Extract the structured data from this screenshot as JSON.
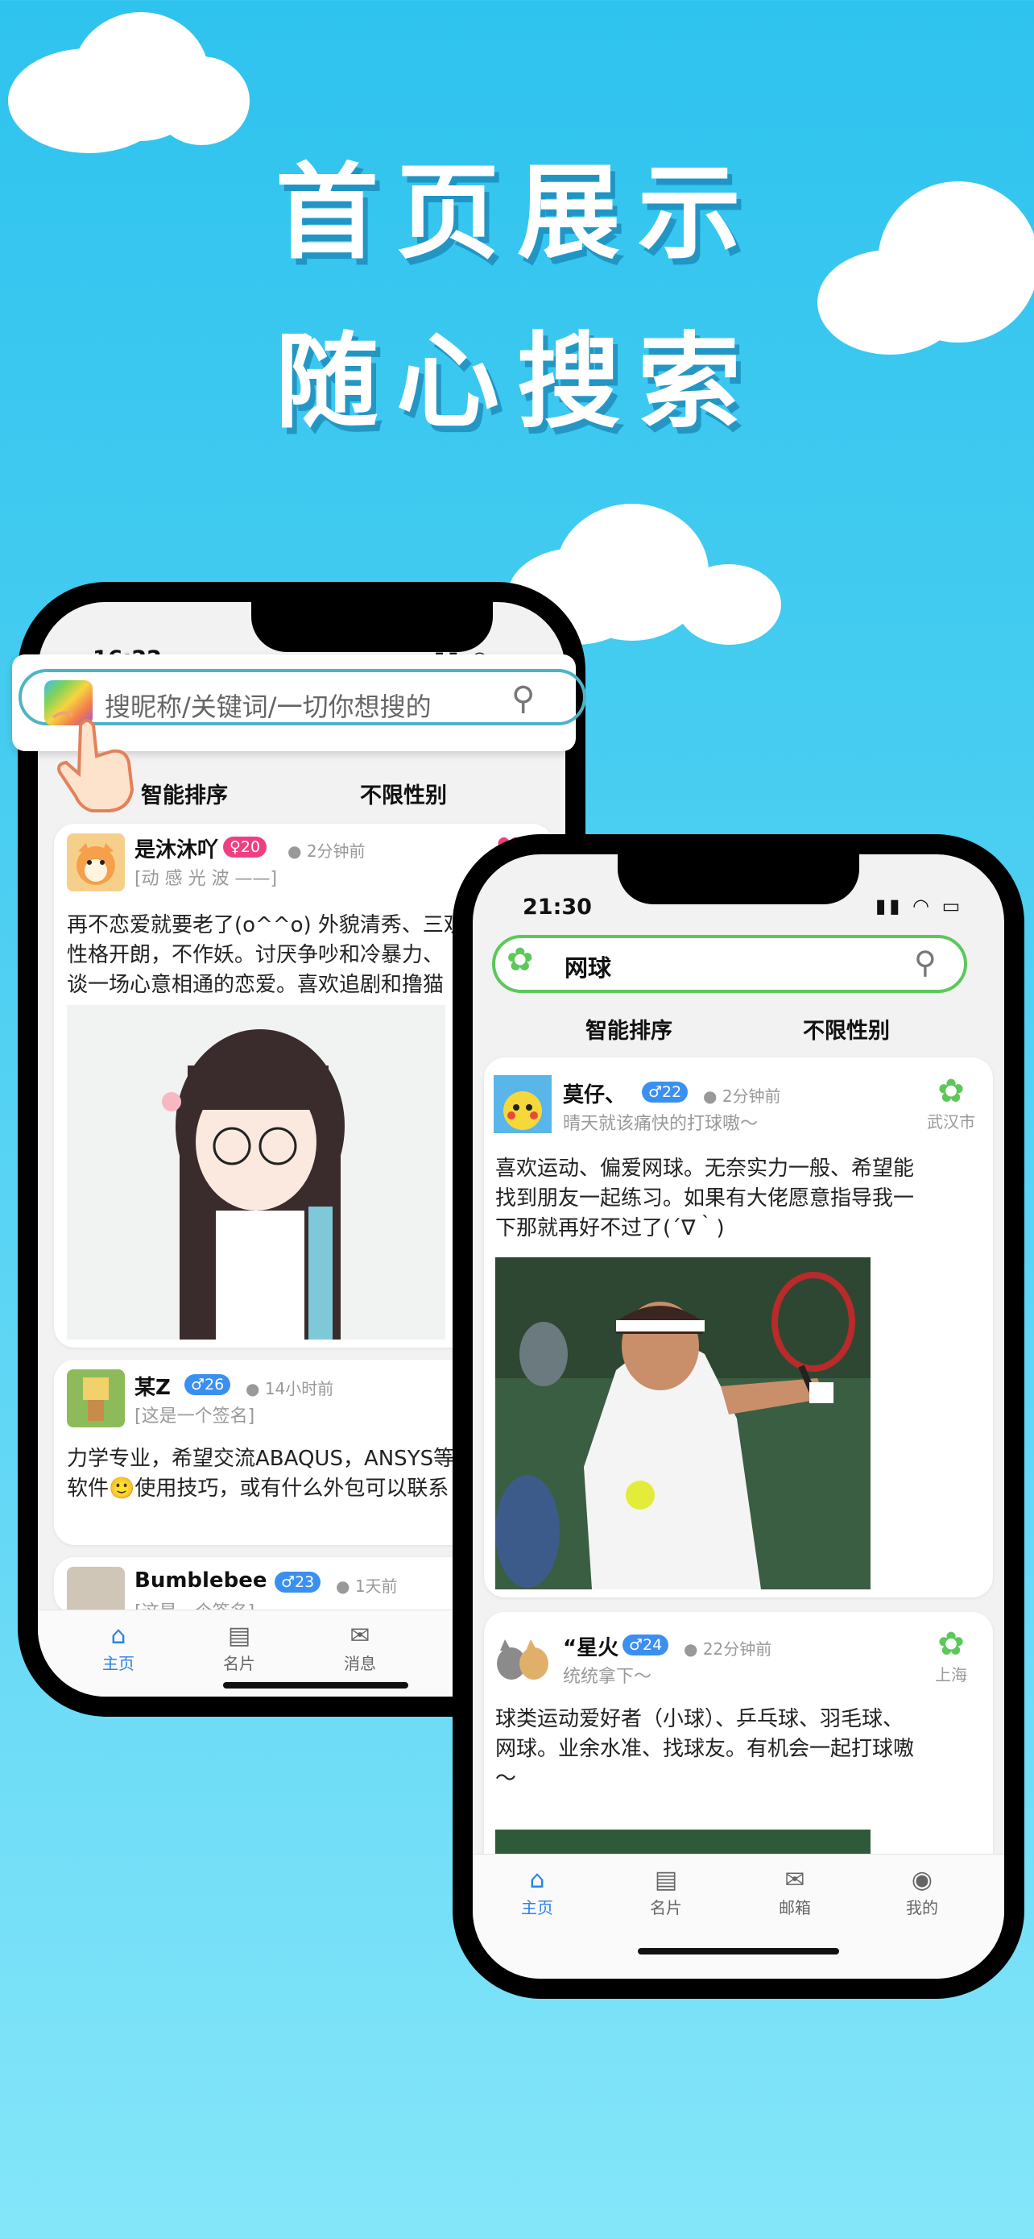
{
  "headline": {
    "line1": "首页展示",
    "line2": "随心搜索"
  },
  "phone_left": {
    "time": "16:22",
    "search": {
      "placeholder": "搜昵称/关键词/一切你想搜的"
    },
    "filters": {
      "sort": "智能排序",
      "gender": "不限性别"
    },
    "posts": [
      {
        "name": "是沐沐吖",
        "age": "20",
        "ago": "2分钟前",
        "signature": "[动 感 光 波 ——]",
        "text": "再不恋爱就要老了(o^^o) 外貌清秀、三观\n性格开朗，不作妖。讨厌争吵和冷暴力、\n谈一场心意相通的恋爱。喜欢追剧和撸猫"
      },
      {
        "name": "某Z",
        "age": "26",
        "ago": "14小时前",
        "signature": "[这是一个签名]",
        "text": "力学专业，希望交流ABAQUS，ANSYS等\n软件🙂使用技巧，或有什么外包可以联系"
      },
      {
        "name": "Bumblebee",
        "age": "23",
        "ago": "1天前",
        "signature": "[这是一个签名]"
      }
    ],
    "tabbar": [
      {
        "label": "主页",
        "icon": "home-icon"
      },
      {
        "label": "名片",
        "icon": "card-icon"
      },
      {
        "label": "消息",
        "icon": "mail-icon"
      }
    ]
  },
  "phone_right": {
    "time": "21:30",
    "search": {
      "value": "网球"
    },
    "filters": {
      "sort": "智能排序",
      "gender": "不限性别"
    },
    "posts": [
      {
        "name": "莫仔、",
        "age": "22",
        "ago": "2分钟前",
        "signature": "晴天就该痛快的打球嗷～",
        "location": "武汉市",
        "text": "喜欢运动、偏爱网球。无奈实力一般、希望能\n找到朋友一起练习。如果有大佬愿意指导我一\n下那就再好不过了(´∇｀)"
      },
      {
        "name": "“星火",
        "age": "24",
        "ago": "22分钟前",
        "signature": "统统拿下～",
        "location": "上海",
        "text": "球类运动爱好者（小球）、乒乓球、羽毛球、\n网球。业余水准、找球友。有机会一起打球嗷\n～"
      }
    ],
    "tabbar": [
      {
        "label": "主页",
        "icon": "home-icon"
      },
      {
        "label": "名片",
        "icon": "card-icon"
      },
      {
        "label": "邮箱",
        "icon": "mail-icon"
      },
      {
        "label": "我的",
        "icon": "profile-icon"
      }
    ]
  },
  "colors": {
    "accent": "#2c82e8",
    "female": "#ee3f82",
    "male": "#3b8ff0",
    "leaf": "#5cc85a"
  }
}
